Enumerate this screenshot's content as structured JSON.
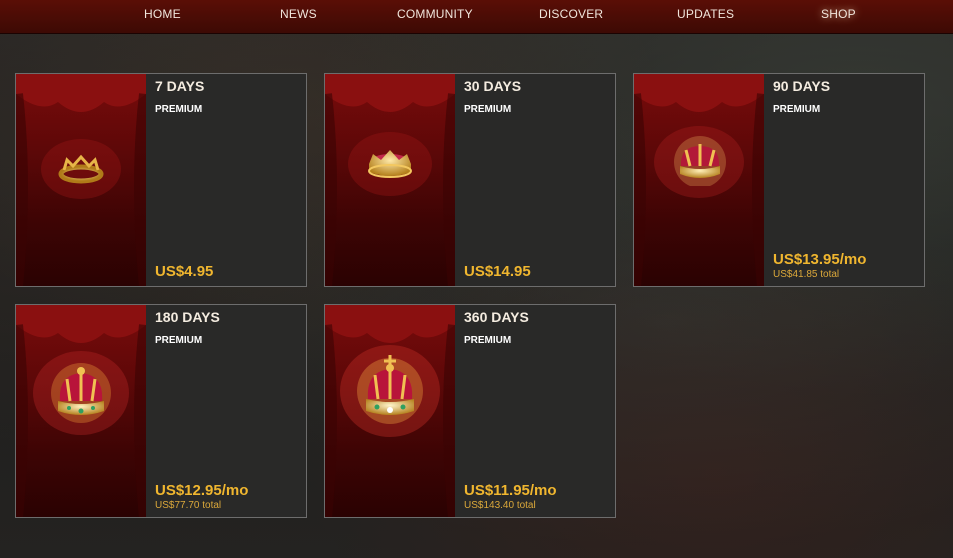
{
  "nav": {
    "items": [
      {
        "label": "HOME"
      },
      {
        "label": "NEWS"
      },
      {
        "label": "COMMUNITY"
      },
      {
        "label": "DISCOVER"
      },
      {
        "label": "UPDATES"
      },
      {
        "label": "SHOP"
      }
    ],
    "active": "SHOP"
  },
  "products": [
    {
      "duration": "7 DAYS",
      "tier": "PREMIUM",
      "price": "US$4.95",
      "total": "",
      "icon": "small-gold-crown-icon"
    },
    {
      "duration": "30 DAYS",
      "tier": "PREMIUM",
      "price": "US$14.95",
      "total": "",
      "icon": "jeweled-gold-crown-icon"
    },
    {
      "duration": "90 DAYS",
      "tier": "PREMIUM",
      "price": "US$13.95/mo",
      "total": "US$41.85 total",
      "icon": "velvet-gold-crown-icon"
    },
    {
      "duration": "180 DAYS",
      "tier": "PREMIUM",
      "price": "US$12.95/mo",
      "total": "US$77.70 total",
      "icon": "royal-crown-icon"
    },
    {
      "duration": "360 DAYS",
      "tier": "PREMIUM",
      "price": "US$11.95/mo",
      "total": "US$143.40 total",
      "icon": "imperial-crown-icon"
    }
  ],
  "colors": {
    "nav_bg": "#4a0c05",
    "curtain": "#5e0808",
    "card_bg": "#292928",
    "price": "#f0b62f"
  }
}
